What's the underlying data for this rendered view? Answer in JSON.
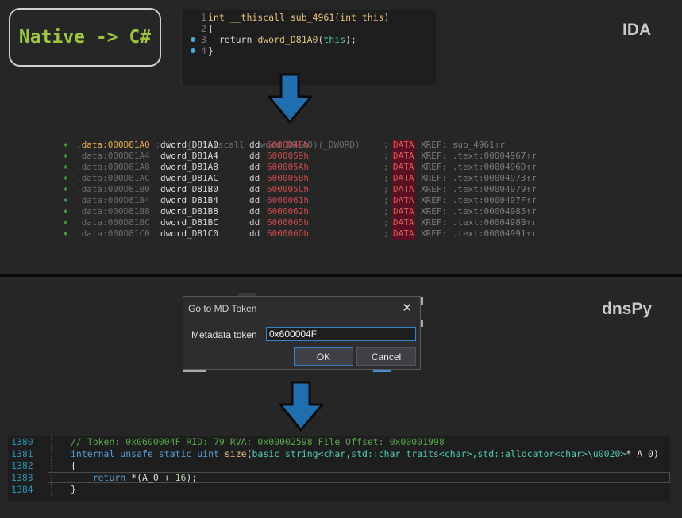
{
  "badge": {
    "text": "Native -> C#"
  },
  "ida": {
    "label": "IDA",
    "pseudocode": [
      {
        "ln": "1",
        "parts": [
          {
            "t": "int __thiscall sub_4961(int this)",
            "c": "kw"
          }
        ]
      },
      {
        "ln": "2",
        "parts": [
          {
            "t": "{",
            "c": "plain"
          }
        ]
      },
      {
        "ln": "3",
        "parts": [
          {
            "t": "  return ",
            "c": "plain"
          },
          {
            "t": "dword_D81A0",
            "c": "fn"
          },
          {
            "t": "(",
            "c": "plain"
          },
          {
            "t": "this",
            "c": "kw-this"
          },
          {
            "t": ");",
            "c": "plain"
          }
        ]
      },
      {
        "ln": "4",
        "parts": [
          {
            "t": "}",
            "c": "plain"
          }
        ]
      }
    ],
    "listing_comment": ".data:000D81A0 ; int (__thiscall *dword_D81A0)(_DWORD)",
    "listing": [
      {
        "addr": ".data:000D81A0",
        "name": "dword_D81A0",
        "op": "dd",
        "val": "600004Fh",
        "xref": "XREF: sub_4961↑r",
        "highlight": true
      },
      {
        "addr": ".data:000D81A4",
        "name": "dword_D81A4",
        "op": "dd",
        "val": "6000059h",
        "xref": "XREF: .text:00004967↑r"
      },
      {
        "addr": ".data:000D81A8",
        "name": "dword_D81A8",
        "op": "dd",
        "val": "600005Ah",
        "xref": "XREF: .text:0000496D↑r"
      },
      {
        "addr": ".data:000D81AC",
        "name": "dword_D81AC",
        "op": "dd",
        "val": "600005Bh",
        "xref": "XREF: .text:00004973↑r"
      },
      {
        "addr": ".data:000D81B0",
        "name": "dword_D81B0",
        "op": "dd",
        "val": "600005Ch",
        "xref": "XREF: .text:00004979↑r"
      },
      {
        "addr": ".data:000D81B4",
        "name": "dword_D81B4",
        "op": "dd",
        "val": "6000061h",
        "xref": "XREF: .text:0000497F↑r"
      },
      {
        "addr": ".data:000D81B8",
        "name": "dword_D81B8",
        "op": "dd",
        "val": "6000062h",
        "xref": "XREF: .text:00004985↑r"
      },
      {
        "addr": ".data:000D81BC",
        "name": "dword_D81BC",
        "op": "dd",
        "val": "6000065h",
        "xref": "XREF: .text:0000498B↑r"
      },
      {
        "addr": ".data:000D81C0",
        "name": "dword_D81C0",
        "op": "dd",
        "val": "600006Dh",
        "xref": "XREF: .text:00004991↑r"
      }
    ],
    "semicolon": ";",
    "data_tag": "DATA"
  },
  "dnspy": {
    "label": "dnsPy",
    "dialog": {
      "title": "Go to MD Token",
      "close": "✕",
      "field_label": "Metadata token",
      "field_value": "0x600004F",
      "ok_label": "OK",
      "cancel_label": "Cancel"
    },
    "code": [
      {
        "ln": "1380",
        "parts": [
          {
            "t": "// Token: 0x0600004F RID: 79 RVA: 0x00002598 File Offset: 0x00001998",
            "c": "c-comment"
          }
        ]
      },
      {
        "ln": "1381",
        "parts": [
          {
            "t": "internal unsafe static uint ",
            "c": "c-kw"
          },
          {
            "t": "size",
            "c": "c-fn"
          },
          {
            "t": "(",
            "c": "c-plain"
          },
          {
            "t": "basic_string<char,std::char_traits<char>,std::allocator<char>\\u0020>",
            "c": "c-type"
          },
          {
            "t": "* ",
            "c": "c-plain"
          },
          {
            "t": "A_0",
            "c": "c-plain"
          },
          {
            "t": ")",
            "c": "c-plain"
          }
        ]
      },
      {
        "ln": "1382",
        "parts": [
          {
            "t": "{",
            "c": "c-plain"
          }
        ]
      },
      {
        "ln": "1383",
        "parts": [
          {
            "t": "    return ",
            "c": "c-kw"
          },
          {
            "t": "*(",
            "c": "c-plain"
          },
          {
            "t": "A_0",
            "c": "c-plain"
          },
          {
            "t": " + ",
            "c": "c-plain"
          },
          {
            "t": "16",
            "c": "c-num"
          },
          {
            "t": ");",
            "c": "c-plain"
          }
        ],
        "current": true
      },
      {
        "ln": "1384",
        "parts": [
          {
            "t": "}",
            "c": "c-plain"
          }
        ]
      }
    ]
  },
  "colors": {
    "badge_text": "#9bc53d",
    "arrow": "#1f6fb0",
    "highlight_addr": "#e0a040",
    "dword_value": "#c94a4a",
    "data_tag_bg": "#5a1020"
  }
}
